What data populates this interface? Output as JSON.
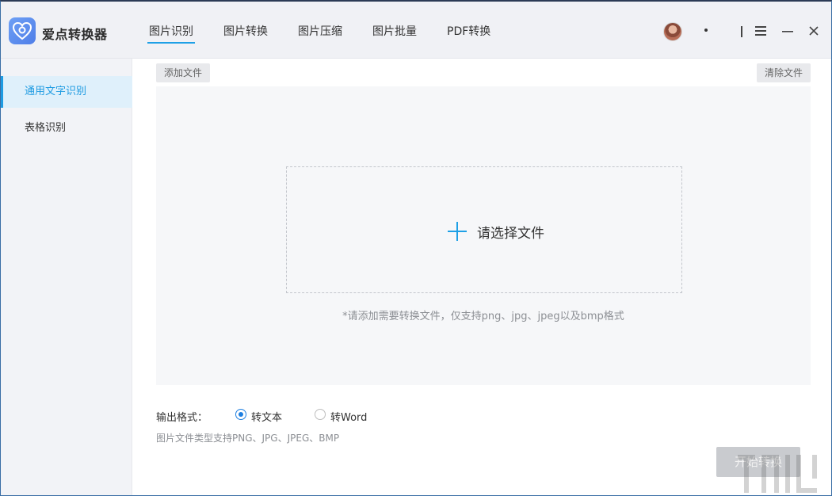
{
  "app": {
    "title": "爱点转换器"
  },
  "nav": {
    "tabs": [
      {
        "label": "图片识别",
        "active": true
      },
      {
        "label": "图片转换"
      },
      {
        "label": "图片压缩"
      },
      {
        "label": "图片批量"
      },
      {
        "label": "PDF转换"
      }
    ]
  },
  "window_controls": {
    "icons": [
      "menu-icon",
      "minimize-icon",
      "close-icon"
    ]
  },
  "sidebar": {
    "items": [
      {
        "label": "通用文字识别",
        "active": true
      },
      {
        "label": "表格识别"
      }
    ]
  },
  "toolbar": {
    "add_label": "添加文件",
    "clear_label": "清除文件"
  },
  "dropzone": {
    "label": "请选择文件",
    "hint": "*请添加需要转换文件，仅支持png、jpg、jpeg以及bmp格式"
  },
  "output": {
    "label": "输出格式：",
    "options": [
      {
        "label": "转文本",
        "selected": true
      },
      {
        "label": "转Word",
        "selected": false
      }
    ],
    "support_text": "图片文件类型支持PNG、JPG、JPEG、BMP"
  },
  "start_button": {
    "label": "开始转换"
  },
  "colors": {
    "accent": "#1e9be2",
    "radio": "#1e7fe0"
  }
}
